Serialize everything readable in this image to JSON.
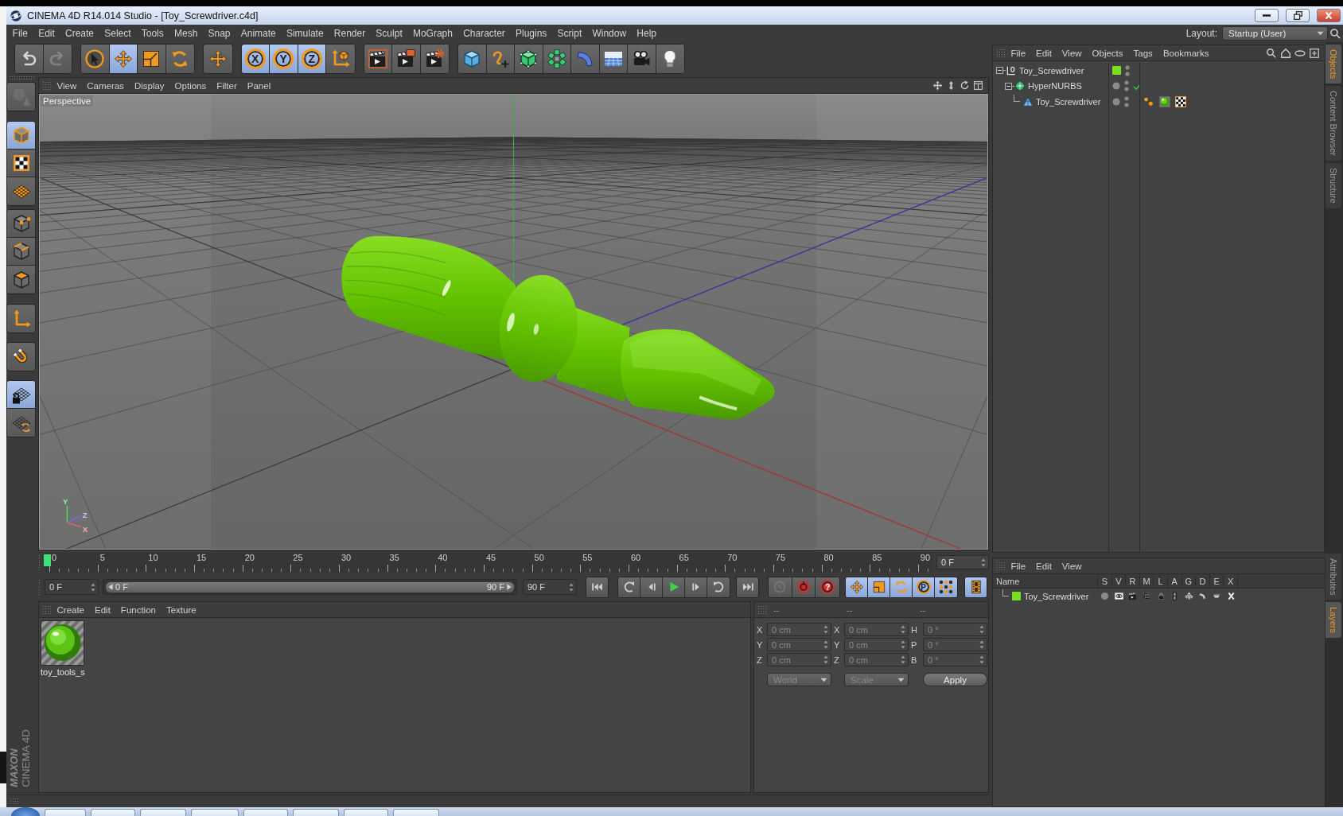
{
  "window": {
    "title": "CINEMA 4D R14.014 Studio - [Toy_Screwdriver.c4d]"
  },
  "menu": [
    "File",
    "Edit",
    "Create",
    "Select",
    "Tools",
    "Mesh",
    "Snap",
    "Animate",
    "Simulate",
    "Render",
    "Sculpt",
    "MoGraph",
    "Character",
    "Plugins",
    "Script",
    "Window",
    "Help"
  ],
  "layout": {
    "label": "Layout:",
    "value": "Startup (User)"
  },
  "toolbar": [
    [
      {
        "kind": "undo",
        "disabled": false
      },
      {
        "kind": "redo",
        "disabled": true
      }
    ],
    [
      {
        "kind": "live-selection",
        "active": false
      },
      {
        "kind": "move",
        "active": true
      },
      {
        "kind": "scale",
        "active": false
      },
      {
        "kind": "rotate",
        "active": false
      }
    ],
    [
      {
        "kind": "recent-tool",
        "active": false
      }
    ],
    [
      {
        "kind": "axis-lock",
        "label": "X",
        "active": true
      },
      {
        "kind": "axis-lock",
        "label": "Y",
        "active": true
      },
      {
        "kind": "axis-lock",
        "label": "Z",
        "active": true
      },
      {
        "kind": "coordinate-system",
        "active": false
      }
    ],
    [
      {
        "kind": "render-view",
        "active": false
      },
      {
        "kind": "render-picture",
        "active": false
      },
      {
        "kind": "render-settings",
        "active": false
      }
    ],
    [
      {
        "kind": "cube",
        "active": false
      },
      {
        "kind": "pen",
        "active": false
      },
      {
        "kind": "subdivision",
        "active": false
      },
      {
        "kind": "array",
        "active": false
      },
      {
        "kind": "deformer",
        "active": false
      },
      {
        "kind": "floor",
        "active": false
      },
      {
        "kind": "camera",
        "active": false
      },
      {
        "kind": "light",
        "active": false
      }
    ]
  ],
  "palette": [
    [
      {
        "kind": "make-editable",
        "disabled": true
      }
    ],
    [
      {
        "kind": "model",
        "active": true
      },
      {
        "kind": "texture",
        "active": false
      },
      {
        "kind": "workplane",
        "active": false
      }
    ],
    [
      {
        "kind": "points",
        "active": false
      },
      {
        "kind": "edges",
        "active": false
      },
      {
        "kind": "polygons",
        "active": false
      }
    ],
    [
      {
        "kind": "axis",
        "active": false
      }
    ],
    [
      {
        "kind": "snap",
        "active": false
      }
    ],
    [
      {
        "kind": "workplane-lock",
        "active": true
      },
      {
        "kind": "workplane-align",
        "active": false
      }
    ]
  ],
  "logo": {
    "brand": "MAXON",
    "product": "CINEMA 4D"
  },
  "viewport": {
    "menu": [
      "View",
      "Cameras",
      "Display",
      "Options",
      "Filter",
      "Panel"
    ],
    "camera": "Perspective",
    "gizmo": [
      "Y",
      "Z",
      "X"
    ]
  },
  "timeline": {
    "ticks": [
      "0",
      "5",
      "10",
      "15",
      "20",
      "25",
      "30",
      "35",
      "40",
      "45",
      "50",
      "55",
      "60",
      "65",
      "70",
      "75",
      "80",
      "85",
      "90"
    ],
    "playhead": {
      "level": 0
    },
    "frame": "0 F"
  },
  "transport": {
    "start": "0 F",
    "range": {
      "from": "0 F",
      "to": "90 F",
      "level": 1
    },
    "end": "90 F",
    "buttons": [
      [
        {
          "kind": "first"
        }
      ],
      [
        {
          "kind": "prev-key"
        },
        {
          "kind": "prev-frame"
        },
        {
          "kind": "play"
        },
        {
          "kind": "next-frame"
        },
        {
          "kind": "next-key"
        }
      ],
      [
        {
          "kind": "last"
        }
      ],
      [
        {
          "kind": "record",
          "disabled": true
        },
        {
          "kind": "autokey",
          "disabled": false
        },
        {
          "kind": "key-selection",
          "label": "?",
          "disabled": false
        }
      ],
      [
        {
          "kind": "key-position",
          "active": true
        },
        {
          "kind": "key-scale",
          "active": true
        },
        {
          "kind": "key-rotation",
          "active": true
        },
        {
          "kind": "key-parameter",
          "label": "P",
          "active": true
        },
        {
          "kind": "key-points",
          "active": true
        }
      ],
      [
        {
          "kind": "timeline",
          "active": true
        }
      ]
    ]
  },
  "materials": {
    "menu": [
      "Create",
      "Edit",
      "Function",
      "Texture"
    ],
    "items": [
      {
        "name": "toy_tools_s"
      }
    ]
  },
  "coordinates": {
    "headers": [
      "--",
      "--",
      "--"
    ],
    "disabled": true,
    "rows": [
      {
        "axes": [
          "X",
          "X",
          "H"
        ],
        "values": [
          "0 cm",
          "0 cm",
          "0 °"
        ]
      },
      {
        "axes": [
          "Y",
          "Y",
          "P"
        ],
        "values": [
          "0 cm",
          "0 cm",
          "0 °"
        ]
      },
      {
        "axes": [
          "Z",
          "Z",
          "B"
        ],
        "values": [
          "0 cm",
          "0 cm",
          "0 °"
        ]
      }
    ],
    "space": "World",
    "mode": "Scale",
    "apply": "Apply"
  },
  "objects": {
    "menu": [
      "File",
      "Edit",
      "View",
      "Objects",
      "Tags",
      "Bookmarks"
    ],
    "tree": [
      {
        "name": "Toy_Screwdriver",
        "kind": "null",
        "color": "#77e21c",
        "expanded": true,
        "children": [
          {
            "name": "HyperNURBS",
            "kind": "subdivision",
            "enabled": true,
            "expanded": true,
            "children": [
              {
                "name": "Toy_Screwdriver",
                "kind": "polygon",
                "tags": [
                  {
                    "kind": "phong"
                  },
                  {
                    "kind": "material"
                  },
                  {
                    "kind": "texture"
                  }
                ]
              }
            ]
          }
        ]
      }
    ]
  },
  "layers": {
    "menu": [
      "File",
      "Edit",
      "View"
    ],
    "columns": [
      "Name",
      "S",
      "V",
      "R",
      "M",
      "L",
      "A",
      "G",
      "D",
      "E",
      "X"
    ],
    "rows": [
      {
        "name": "Toy_Screwdriver",
        "color": "#77e21c"
      }
    ]
  },
  "side_tabs": {
    "top": [
      {
        "label": "Objects",
        "selected": true
      },
      {
        "label": "Content Browser",
        "selected": false
      },
      {
        "label": "Structure",
        "selected": false
      }
    ],
    "bottom": [
      {
        "label": "Attributes",
        "selected": false
      },
      {
        "label": "Layers",
        "selected": true
      }
    ]
  }
}
